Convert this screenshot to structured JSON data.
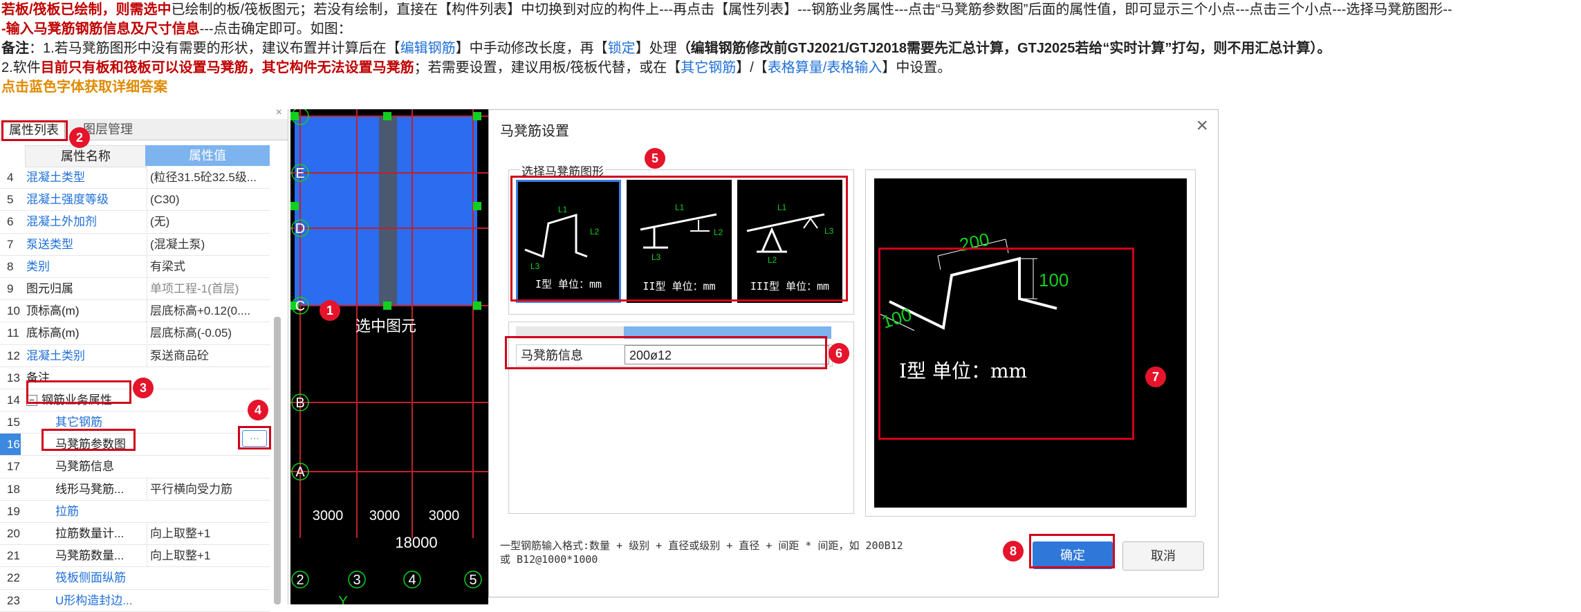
{
  "instructions": {
    "line1": {
      "p1": "若板/筏板已绘制，则需选中",
      "p2": "已绘制的板/筏板图元；若没有绘制，直接在【构件列表】中切换到对应的构件上---再点击【属性列表】---钢筋业务属性---点击“马凳筋参数图”后面的属性值，即可显示三个小点---点击三个小点---选择马凳筋图形--"
    },
    "line2": {
      "p1": "-输入马凳筋钢筋信息及尺寸信息",
      "p2": "---点击确定即可。如图："
    },
    "line3": {
      "p1": "备注",
      "p2": "：1.若马凳筋图形中没有需要的形状，建议布置并计算后在【",
      "link1": "编辑钢筋",
      "p3": "】中手动修改长度，再【",
      "link2": "锁定",
      "p4": "】处理",
      "p5": "（编辑钢筋修改前GTJ2021/GTJ2018需要先汇总计算，GTJ2025若给“实时计算”打勾，则不用汇总计算）。"
    },
    "line4": {
      "p1": "2.软件",
      "p2": "目前只有板和筏板可以设置马凳筋，其它构件无法设置马凳筋",
      "p3": "；若需要设置，建议用板/筏板代替，或在【",
      "link1": "其它钢筋",
      "p4": "】/【",
      "link2": "表格算量/表格输入",
      "p5": "】中设置。"
    },
    "line5": "点击蓝色字体获取详细答案"
  },
  "property_panel": {
    "tab_active": "属性列表",
    "tab_other": "图层管理",
    "close": "×",
    "col_name": "属性名称",
    "col_value": "属性值",
    "rows": [
      {
        "num": "4",
        "name": "混凝土类型",
        "value": "(粒径31.5砼32.5级...",
        "blue": true
      },
      {
        "num": "5",
        "name": "混凝土强度等级",
        "value": "(C30)",
        "blue": true
      },
      {
        "num": "6",
        "name": "混凝土外加剂",
        "value": "(无)",
        "blue": true
      },
      {
        "num": "7",
        "name": "泵送类型",
        "value": "(混凝土泵)",
        "blue": true
      },
      {
        "num": "8",
        "name": "类别",
        "value": "有梁式",
        "blue": true
      },
      {
        "num": "9",
        "name": "图元归属",
        "value": "单项工程-1(首层)",
        "blue": false,
        "grey": true
      },
      {
        "num": "10",
        "name": "顶标高(m)",
        "value": "层底标高+0.12(0....",
        "blue": false
      },
      {
        "num": "11",
        "name": "底标高(m)",
        "value": "层底标高(-0.05)",
        "blue": false
      },
      {
        "num": "12",
        "name": "混凝土类别",
        "value": "泵送商品砼",
        "blue": true
      },
      {
        "num": "13",
        "name": "备注",
        "value": "",
        "blue": false
      },
      {
        "num": "14",
        "name": "钢筋业务属性",
        "value": "",
        "blue": false,
        "group": true
      },
      {
        "num": "15",
        "name": "其它钢筋",
        "value": "",
        "blue": true,
        "indent": true
      },
      {
        "num": "16",
        "name": "马凳筋参数图",
        "value": "",
        "blue": false,
        "indent": true,
        "selected": true
      },
      {
        "num": "17",
        "name": "马凳筋信息",
        "value": "",
        "blue": false,
        "indent": true
      },
      {
        "num": "18",
        "name": "线形马凳筋...",
        "value": "平行横向受力筋",
        "blue": false,
        "indent": true
      },
      {
        "num": "19",
        "name": "拉筋",
        "value": "",
        "blue": true,
        "indent": true
      },
      {
        "num": "20",
        "name": "拉筋数量计...",
        "value": "向上取整+1",
        "blue": false,
        "indent": true
      },
      {
        "num": "21",
        "name": "马凳筋数量...",
        "value": "向上取整+1",
        "blue": false,
        "indent": true
      },
      {
        "num": "22",
        "name": "筏板侧面纵筋",
        "value": "",
        "blue": true,
        "indent": true
      },
      {
        "num": "23",
        "name": "U形构造封边...",
        "value": "",
        "blue": true,
        "indent": true
      }
    ],
    "ellipsis": "···",
    "toggle": "−"
  },
  "cad": {
    "row_axes": [
      "E",
      "D",
      "C",
      "B",
      "A"
    ],
    "col_axes": [
      "2",
      "3",
      "4",
      "5"
    ],
    "dims": [
      "3000",
      "3000",
      "3000"
    ],
    "total_dim": "18000",
    "selected_label": "选中图元",
    "y_axis": "Y",
    "colors": {
      "slab": "#2b6cf0",
      "grid": "#c0202a",
      "handle": "#10d020"
    }
  },
  "dialog": {
    "title": "马凳筋设置",
    "close": "×",
    "group_label": "选择马凳筋图形",
    "shapes": [
      {
        "caption": "I型 单位：mm"
      },
      {
        "caption": "II型 单位：mm"
      },
      {
        "caption": "III型 单位：mm"
      }
    ],
    "shape_labels": {
      "l1": "L1",
      "l2": "L2",
      "l3": "L3"
    },
    "info_label": "马凳筋信息",
    "info_value": "200ø12",
    "preview": {
      "dim_top": "200",
      "dim_right": "100",
      "dim_left": "100",
      "caption": "I型  单位：mm"
    },
    "hint_line1": "一型钢筋输入格式:数量 + 级别 + 直径或级别 + 直径 + 间距 * 间距，如 200B12",
    "hint_line2": "或 B12@1000*1000",
    "ok": "确定",
    "cancel": "取消"
  },
  "badges": [
    "1",
    "2",
    "3",
    "4",
    "5",
    "6",
    "7",
    "8"
  ]
}
